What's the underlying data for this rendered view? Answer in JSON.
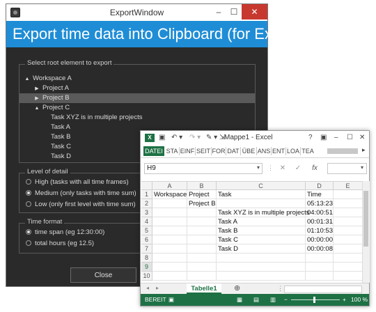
{
  "export_window": {
    "title": "ExportWindow",
    "header": "Export time data into Clipboard (for Excel)",
    "root_group_label": "Select root element to export",
    "tree": [
      {
        "label": "Workspace A",
        "level": 0,
        "arrow": "▲",
        "selected": false
      },
      {
        "label": "Project A",
        "level": 1,
        "arrow": "▶",
        "selected": false
      },
      {
        "label": "Project B",
        "level": 1,
        "arrow": "▶",
        "selected": true
      },
      {
        "label": "Project C",
        "level": 1,
        "arrow": "▲",
        "selected": false
      },
      {
        "label": "Task XYZ is in multiple projects",
        "level": 2,
        "arrow": "",
        "selected": false
      },
      {
        "label": "Task A",
        "level": 2,
        "arrow": "",
        "selected": false
      },
      {
        "label": "Task B",
        "level": 2,
        "arrow": "",
        "selected": false
      },
      {
        "label": "Task C",
        "level": 2,
        "arrow": "",
        "selected": false
      },
      {
        "label": "Task D",
        "level": 2,
        "arrow": "",
        "selected": false
      }
    ],
    "detail_group_label": "Level of detail",
    "detail_options": [
      {
        "label": "High (tasks with all time frames)",
        "checked": false
      },
      {
        "label": "Medium (only tasks with time sum)",
        "checked": true
      },
      {
        "label": "Low (only first level with time sum)",
        "checked": false
      }
    ],
    "time_group_label": "Time format",
    "time_options": [
      {
        "label": "time span (eg 12:30:00)",
        "checked": true
      },
      {
        "label": "total hours (eg 12.5)",
        "checked": false
      }
    ],
    "close_label": "Close",
    "header_color": "#1f8dd6"
  },
  "excel": {
    "title": "Mappe1 - Excel",
    "help": "?",
    "ribbon_tabs": [
      "DATEI",
      "STA",
      "EINF",
      "SEIT",
      "FOR",
      "DAT",
      "ÜBE",
      "ANS",
      "ENT",
      "LOA",
      "TEA"
    ],
    "name_box": "H9",
    "columns": [
      "A",
      "B",
      "C",
      "D",
      "E"
    ],
    "rows": [
      [
        "Workspace",
        "Project",
        "Task",
        "Time",
        ""
      ],
      [
        "",
        "Project B",
        "",
        "05:13:23",
        ""
      ],
      [
        "",
        "",
        "Task XYZ is in multiple projects",
        "04:00:51",
        ""
      ],
      [
        "",
        "",
        "Task A",
        "00:01:31",
        ""
      ],
      [
        "",
        "",
        "Task B",
        "01:10:53",
        ""
      ],
      [
        "",
        "",
        "Task C",
        "00:00:00",
        ""
      ],
      [
        "",
        "",
        "Task D",
        "00:00:08",
        ""
      ],
      [
        "",
        "",
        "",
        "",
        ""
      ],
      [
        "",
        "",
        "",
        "",
        ""
      ],
      [
        "",
        "",
        "",
        "",
        ""
      ]
    ],
    "row_numbers": [
      "1",
      "2",
      "3",
      "4",
      "5",
      "6",
      "7",
      "8",
      "9",
      "10"
    ],
    "sheet_tab": "Tabelle1",
    "status_text": "BEREIT",
    "zoom": "100 %",
    "accent_color": "#1e7145"
  }
}
